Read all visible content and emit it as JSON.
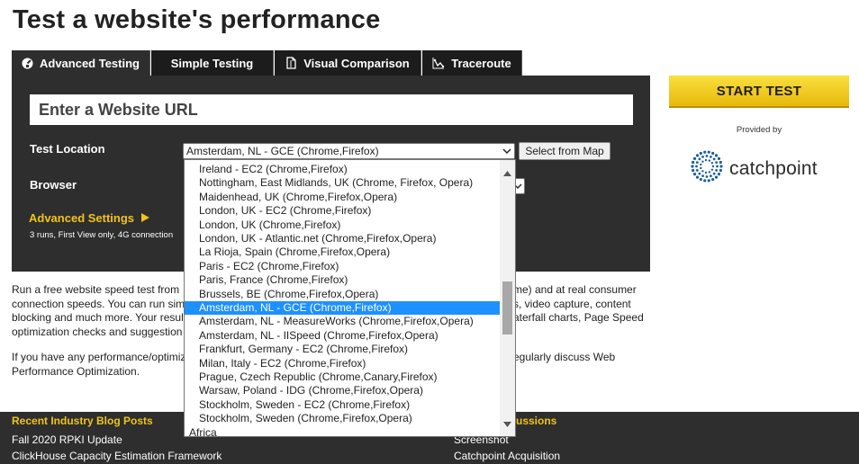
{
  "page": {
    "title": "Test a website's performance"
  },
  "tabs": [
    {
      "label": "Advanced Testing",
      "icon": "gauge-icon",
      "active": true
    },
    {
      "label": "Simple Testing",
      "icon": "",
      "active": false
    },
    {
      "label": "Visual Comparison",
      "icon": "document-compare-icon",
      "active": false
    },
    {
      "label": "Traceroute",
      "icon": "traceroute-icon",
      "active": false
    }
  ],
  "form": {
    "url_placeholder": "Enter a Website URL",
    "test_location_label": "Test Location",
    "test_location_value": "Amsterdam, NL - GCE (Chrome,Firefox)",
    "select_from_map": "Select from Map",
    "browser_label": "Browser",
    "advanced_settings": "Advanced Settings",
    "advanced_summary": "3 runs, First View only, 4G connection"
  },
  "sidebar": {
    "start_test": "START TEST",
    "provided_by": "Provided by",
    "provider_name": "catchpoint"
  },
  "intro": {
    "line1_left": "Run a free website speed test from",
    "line1_right": "me) and at real consumer",
    "line2_left": "connection speeds. You can run sim",
    "line2_right": "s, video capture, content",
    "line3_left": "blocking and much more. Your resul",
    "line3_right": "aterfall charts, Page Speed",
    "line4_left": "optimization checks and suggestion",
    "p2_line1_left": "If you have any performance/optimiz",
    "p2_line1_right": "egularly discuss Web",
    "p2_line2": "Performance Optimization."
  },
  "footer": {
    "blog_heading": "Recent Industry Blog Posts",
    "discussions_heading": "ussions",
    "blog_posts": [
      "Fall 2020 RPKI Update",
      "ClickHouse Capacity Estimation Framework"
    ],
    "discussions": [
      "Screenshot",
      "Catchpoint Acquisition"
    ]
  },
  "location_dropdown": {
    "items": [
      "Ireland - EC2 (Chrome,Firefox)",
      "Nottingham, East Midlands, UK (Chrome, Firefox, Opera)",
      "Maidenhead, UK (Chrome,Firefox,Opera)",
      "London, UK - EC2 (Chrome,Firefox)",
      "London, UK (Chrome,Firefox)",
      "London, UK - Atlantic.net (Chrome,Firefox,Opera)",
      "La Rioja, Spain (Chrome,Firefox,Opera)",
      "Paris - EC2 (Chrome,Firefox)",
      "Paris, France (Chrome,Firefox)",
      "Brussels, BE (Chrome,Firefox,Opera)",
      "Amsterdam, NL - GCE (Chrome,Firefox)",
      "Amsterdam, NL - MeasureWorks (Chrome,Firefox,Opera)",
      "Amsterdam, NL - IISpeed (Chrome,Firefox,Opera)",
      "Frankfurt, Germany - EC2 (Chrome,Firefox)",
      "Milan, Italy - EC2 (Chrome,Firefox)",
      "Prague, Czech Republic (Chrome,Canary,Firefox)",
      "Warsaw, Poland - IDG (Chrome,Firefox,Opera)",
      "Stockholm, Sweden - EC2 (Chrome,Firefox)",
      "Stockholm, Sweden (Chrome,Firefox,Opera)"
    ],
    "selected_index": 10,
    "next_group": "Africa"
  },
  "colors": {
    "panel": "#2e2e2e",
    "accent_yellow": "#f0c419",
    "button_yellow": "#f5d020",
    "selection_blue": "#1e90ff",
    "catchpoint_blue": "#1a5f9e"
  }
}
